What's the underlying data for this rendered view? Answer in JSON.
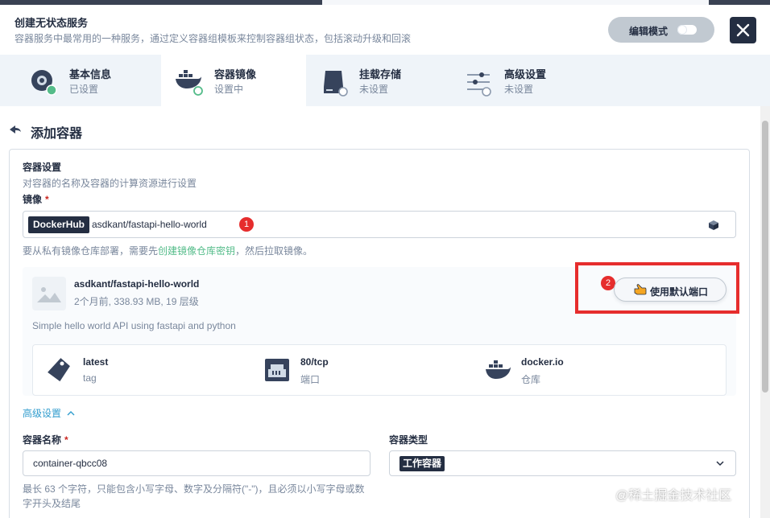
{
  "header": {
    "title": "创建无状态服务",
    "subtitle": "容器服务中最常用的一种服务，通过定义容器组模板来控制容器组状态，包括滚动升级和回滚",
    "edit_mode_label": "编辑模式",
    "close_icon": "close-icon"
  },
  "steps": [
    {
      "name": "基本信息",
      "state": "已设置",
      "icon": "basic-info-icon"
    },
    {
      "name": "容器镜像",
      "state": "设置中",
      "icon": "docker-icon"
    },
    {
      "name": "挂载存储",
      "state": "未设置",
      "icon": "storage-icon"
    },
    {
      "name": "高级设置",
      "state": "未设置",
      "icon": "sliders-icon"
    }
  ],
  "page": {
    "back_title": "添加容器"
  },
  "container_settings": {
    "title": "容器设置",
    "description": "对容器的名称及容器的计算资源进行设置",
    "image_label": "镜像",
    "required_mark": "*",
    "registry_tag": "DockerHub",
    "image_value": "asdkant/fastapi-hello-world",
    "badge_1": "1",
    "hint_prefix": "要从私有镜像仓库部署，需要先",
    "hint_link": "创建镜像仓库密钥",
    "hint_suffix": "，然后拉取镜像。"
  },
  "image_card": {
    "name": "asdkant/fastapi-hello-world",
    "meta": "2个月前, 338.93 MB, 19 层级",
    "description": "Simple hello world API using fastapi and python",
    "badge_2": "2",
    "use_default_port_label": "使用默认端口",
    "info": [
      {
        "value": "latest",
        "key": "tag",
        "icon": "tag-icon"
      },
      {
        "value": "80/tcp",
        "key": "端口",
        "icon": "port-icon"
      },
      {
        "value": "docker.io",
        "key": "仓库",
        "icon": "docker-icon"
      }
    ]
  },
  "advanced": {
    "toggle_label": "高级设置",
    "container_name_label": "容器名称",
    "container_name_value": "container-qbcc08",
    "container_type_label": "容器类型",
    "container_type_value": "工作容器",
    "name_help": "最长 63 个字符，只能包含小写字母、数字及分隔符(\"-\")，且必须以小写字母或数字开头及结尾"
  },
  "watermark": "@稀土掘金技术社区",
  "colors": {
    "accent_green": "#55bc8a",
    "link_blue": "#329dce",
    "badge_red": "#e62d2d",
    "dark": "#242e42"
  }
}
